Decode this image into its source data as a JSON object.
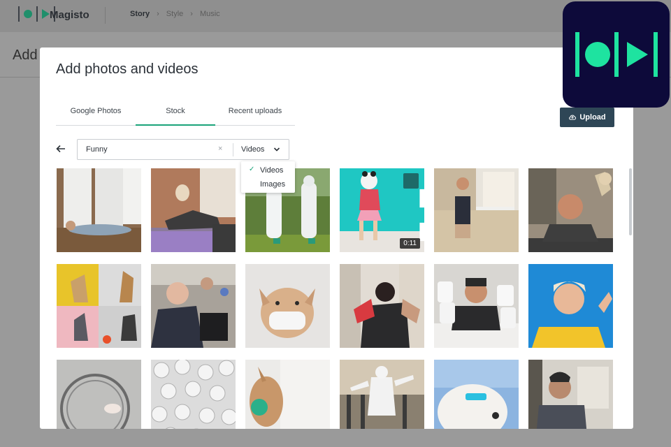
{
  "app": {
    "brand": "Magisto"
  },
  "nav": {
    "steps": [
      "Story",
      "Style",
      "Music"
    ],
    "chevron": "›"
  },
  "background": {
    "page_title": "Add"
  },
  "modal": {
    "title": "Add photos and videos",
    "tabs": [
      "Google Photos",
      "Stock",
      "Recent uploads"
    ],
    "active_tab": "Stock",
    "upload_label": "Upload",
    "search": {
      "value": "Funny",
      "clear_glyph": "×"
    },
    "media_type": {
      "selected": "Videos",
      "options": [
        "Videos",
        "Images"
      ]
    }
  },
  "grid": {
    "rows": [
      [
        {
          "scene": "man lying on floor by white doors"
        },
        {
          "scene": "woman doing yoga with dog on back"
        },
        {
          "scene": "people in hazmat suits on grass"
        },
        {
          "scene": "person in panda mask dancing on teal wall",
          "duration": "0:11"
        },
        {
          "scene": "man working at laptop"
        },
        {
          "scene": "man doing push-ups with dog"
        }
      ],
      [
        {
          "scene": "dog video call collage"
        },
        {
          "scene": "stressed man at laptop"
        },
        {
          "scene": "pug wearing face mask"
        },
        {
          "scene": "excited man jumping"
        },
        {
          "scene": "man hugging toilet paper rolls"
        },
        {
          "scene": "smiling woman in yellow on blue"
        }
      ],
      [
        {
          "scene": "hamster in wheel"
        },
        {
          "scene": "pile of toilet paper rolls"
        },
        {
          "scene": "rabbit with green mask"
        },
        {
          "scene": "person in protective suit dancing"
        },
        {
          "scene": "fluffy dog with sunglasses"
        },
        {
          "scene": "woman laughing at home"
        }
      ]
    ]
  },
  "colors": {
    "accent": "#1aa37a",
    "upload_button": "#2e4656",
    "icon_bg": "#0d0a3a",
    "icon_fg": "#1ee3a0"
  },
  "icons": {
    "back": "arrow-left-icon",
    "upload": "cloud-upload-icon",
    "clear": "close-icon",
    "dropdown": "chevron-down-icon",
    "selected": "check-icon",
    "expand": "expand-icon"
  }
}
